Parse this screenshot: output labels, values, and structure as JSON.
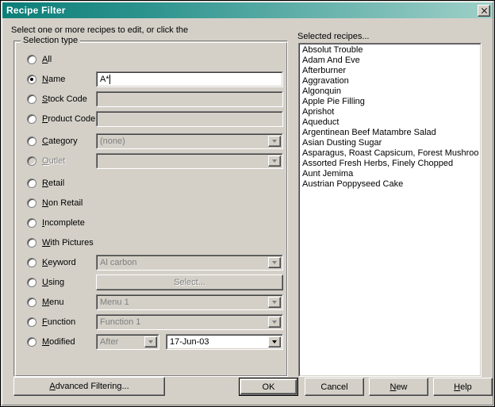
{
  "window": {
    "title": "Recipe Filter",
    "close_icon": "close-icon"
  },
  "header": {
    "hint": "Select one or more recipes to edit, or click the",
    "list_label": "Selected recipes..."
  },
  "group": {
    "title": "Selection type"
  },
  "options": [
    {
      "id": "all",
      "label": "All",
      "accel": "A",
      "checked": false,
      "enabled": true,
      "control": "none"
    },
    {
      "id": "name",
      "label": "Name",
      "accel": "N",
      "checked": true,
      "enabled": true,
      "control": "text",
      "value": "A*",
      "control_enabled": true
    },
    {
      "id": "stock-code",
      "label": "Stock Code",
      "accel": "S",
      "checked": false,
      "enabled": true,
      "control": "text",
      "value": "",
      "control_enabled": false
    },
    {
      "id": "product-code",
      "label": "Product Code",
      "accel": "P",
      "checked": false,
      "enabled": true,
      "control": "text",
      "value": "",
      "control_enabled": false
    },
    {
      "id": "category",
      "label": "Category",
      "accel": "C",
      "checked": false,
      "enabled": true,
      "control": "combo",
      "value": "(none)",
      "control_enabled": false
    },
    {
      "id": "outlet",
      "label": "Outlet",
      "accel": "O",
      "checked": false,
      "enabled": false,
      "control": "combo",
      "value": "",
      "control_enabled": false
    },
    {
      "id": "retail",
      "label": "Retail",
      "accel": "R",
      "checked": false,
      "enabled": true,
      "control": "none"
    },
    {
      "id": "non-retail",
      "label": "Non Retail",
      "accel": "N",
      "checked": false,
      "enabled": true,
      "control": "none"
    },
    {
      "id": "incomplete",
      "label": "Incomplete",
      "accel": "I",
      "checked": false,
      "enabled": true,
      "control": "none"
    },
    {
      "id": "with-pictures",
      "label": "With Pictures",
      "accel": "W",
      "checked": false,
      "enabled": true,
      "control": "none"
    },
    {
      "id": "keyword",
      "label": "Keyword",
      "accel": "K",
      "checked": false,
      "enabled": true,
      "control": "combo",
      "value": "Al carbon",
      "control_enabled": false
    },
    {
      "id": "using",
      "label": "Using",
      "accel": "U",
      "checked": false,
      "enabled": true,
      "control": "button",
      "value": "Select...",
      "control_enabled": false
    },
    {
      "id": "menu",
      "label": "Menu",
      "accel": "M",
      "checked": false,
      "enabled": true,
      "control": "combo",
      "value": "Menu 1",
      "control_enabled": false
    },
    {
      "id": "function",
      "label": "Function",
      "accel": "F",
      "checked": false,
      "enabled": true,
      "control": "combo",
      "value": "Function 1",
      "control_enabled": false
    },
    {
      "id": "modified",
      "label": "Modified",
      "accel": "M",
      "checked": false,
      "enabled": true,
      "control": "modified",
      "value": "After",
      "control_enabled": false,
      "date_value": "17-Jun-03",
      "date_enabled": true
    }
  ],
  "recipes": [
    "Absolut Trouble",
    "Adam And Eve",
    "Afterburner",
    "Aggravation",
    "Algonquin",
    "Apple Pie Filling",
    "Aprishot",
    "Aqueduct",
    "Argentinean Beef Matambre Salad",
    "Asian Dusting Sugar",
    "Asparagus, Roast Capsicum, Forest Mushroom &",
    "Assorted Fresh Herbs, Finely Chopped",
    "Aunt Jemima",
    "Austrian Poppyseed Cake"
  ],
  "buttons": {
    "advanced": {
      "label": "Advanced Filtering...",
      "accel": "A"
    },
    "ok": {
      "label": "OK",
      "accel": "",
      "default": true
    },
    "cancel": {
      "label": "Cancel",
      "accel": ""
    },
    "new": {
      "label": "New",
      "accel": "N"
    },
    "help": {
      "label": "Help",
      "accel": "H"
    }
  },
  "colors": {
    "face": "#d4d0c8",
    "title_start": "#0c7e78",
    "title_end": "#9ed0c8",
    "field_bg": "#ffffff",
    "disabled_text": "#808080"
  }
}
